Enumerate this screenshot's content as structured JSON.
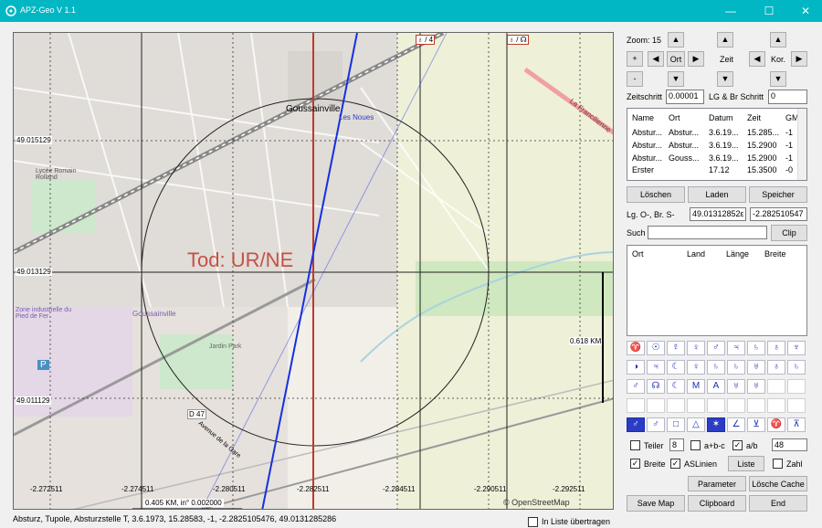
{
  "window": {
    "title": "APZ-Geo V 1.1",
    "minimize": "—",
    "maximize": "☐",
    "close": "✕"
  },
  "map": {
    "overlay_text": "Tod: UR/NE",
    "lat_labels": [
      "49.015129",
      "49.013129",
      "49.011129"
    ],
    "lon_labels": [
      "-2.272511",
      "-2.274511",
      "-2.280511",
      "-2.282511",
      "-2.284511",
      "-2.290511",
      "-2.292511"
    ],
    "distance_label": "0.618 KM",
    "scale_text": "0.405 KM, in° 0.002000",
    "attribution": "© OpenStreetMap contributors",
    "top_markers": [
      "♁ / 4",
      "♁ / ☊"
    ],
    "place_labels": [
      "Goussainville",
      "Les Noues",
      "Goussainville",
      "Zone industrielle du Pied de Fer",
      "Lycée Romain Rolland",
      "Avenue de la Gare",
      "D 47",
      "P",
      "La Francilienne",
      "Jardin Park"
    ]
  },
  "status": {
    "text": "Absturz, Tupole, Absturzstelle T, 3.6.1973, 15.28583, -1, -2.2825105476, 49.0131285286",
    "in_liste_label": "In Liste übertragen"
  },
  "controls": {
    "zoom_label": "Zoom: 15",
    "zeit_label": "Zeit",
    "kor_label": "Kor.",
    "ort_button": "Ort",
    "plus": "+",
    "minus": "-",
    "zeitschritt_label": "Zeitschritt",
    "zeitschritt_value": "0.00001",
    "lgbr_schritt_label": "LG & Br Schritt",
    "lgbr_schritt_value": "0"
  },
  "table": {
    "headers": [
      "Name",
      "Ort",
      "Datum",
      "Zeit",
      "GM"
    ],
    "rows": [
      [
        "Abstur...",
        "Abstur...",
        "3.6.19...",
        "15.285...",
        "-1"
      ],
      [
        "Abstur...",
        "Abstur...",
        "3.6.19...",
        "15.2900",
        "-1"
      ],
      [
        "Abstur...",
        "Gouss...",
        "3.6.19...",
        "15.2900",
        "-1"
      ],
      [
        "Erster",
        "",
        "17.12",
        "15.3500",
        "-0"
      ]
    ]
  },
  "buttons": {
    "loeschen": "Löschen",
    "laden": "Laden",
    "speicher": "Speicher",
    "clip": "Clip",
    "liste": "Liste",
    "parameter": "Parameter",
    "loesche_cache": "Lösche Cache",
    "save_map": "Save Map",
    "clipboard": "Clipboard",
    "end": "End"
  },
  "coords": {
    "label": "Lg. O-, Br. S-",
    "lat_value": "49.01312852ε",
    "lon_value": "-2.282510547"
  },
  "search": {
    "label": "Such",
    "value": "",
    "headers": [
      "Ort",
      "Land",
      "Länge",
      "Breite"
    ]
  },
  "glyphs": {
    "row1": [
      "♈",
      "☉",
      "☿",
      "♀",
      "♂",
      "♃",
      "♄",
      "♁",
      "♆"
    ],
    "row2": [
      "◑",
      "♃",
      "☾",
      "♀",
      "♄",
      "♄",
      "♅",
      "♁",
      "♄"
    ],
    "row3": [
      "♂",
      "☊",
      "☾",
      "M",
      "A",
      "♅",
      "♅"
    ],
    "row5": [
      "♂",
      "♂",
      "□",
      "△",
      "✶",
      "∠",
      "⊻",
      "♈",
      "⊼"
    ]
  },
  "options": {
    "teiler_label": "Teiler",
    "teiler_value": "8",
    "abc_label": "a+b-c",
    "ab_label": "a/b",
    "ab_value": "48",
    "breite_label": "Breite",
    "aslinien_label": "ASLinien",
    "zahl_label": "Zahl"
  },
  "colors": {
    "titlebar": "#00b7c3",
    "glyph_blue": "#1a2db5",
    "red_line": "#c0392b",
    "blue_line": "#1530e0"
  }
}
